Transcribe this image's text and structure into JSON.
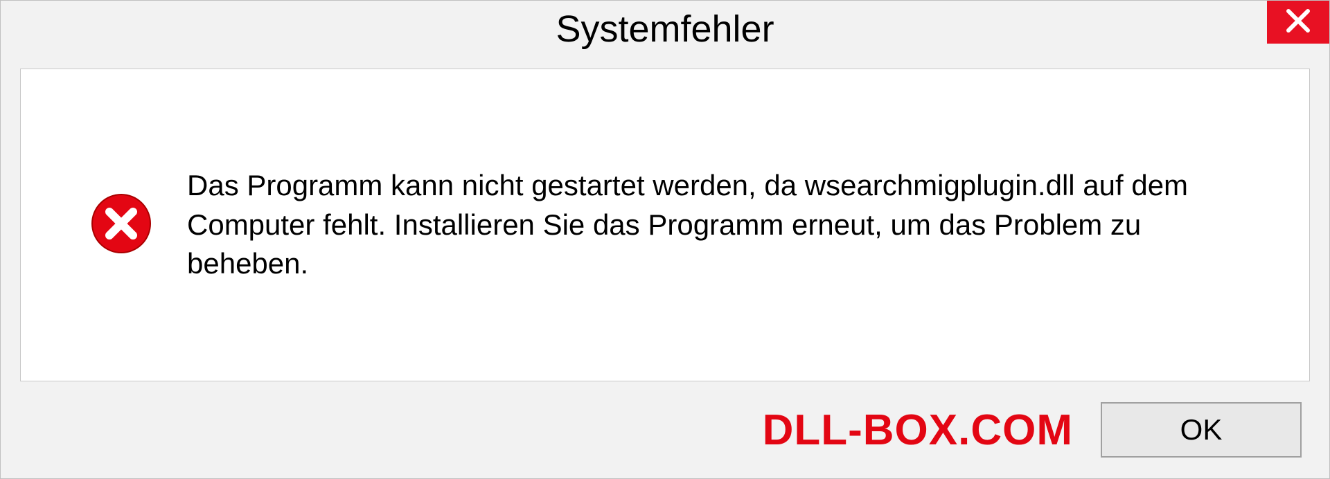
{
  "titlebar": {
    "title": "Systemfehler"
  },
  "dialog": {
    "message": "Das Programm kann nicht gestartet werden, da wsearchmigplugin.dll auf dem Computer fehlt. Installieren Sie das Programm erneut, um das Problem zu beheben."
  },
  "footer": {
    "watermark": "DLL-BOX.COM",
    "ok_label": "OK"
  }
}
